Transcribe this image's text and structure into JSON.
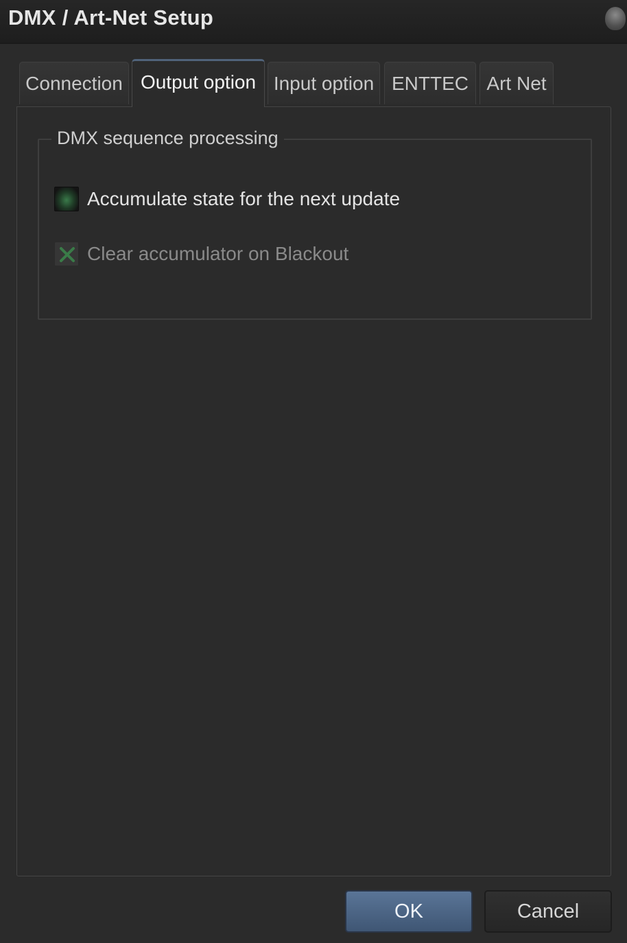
{
  "window": {
    "title": "DMX / Art-Net Setup"
  },
  "tabs": [
    {
      "label": "Connection",
      "active": false
    },
    {
      "label": "Output option",
      "active": true
    },
    {
      "label": "Input option",
      "active": false
    },
    {
      "label": "ENTTEC",
      "active": false
    },
    {
      "label": "Art Net",
      "active": false
    }
  ],
  "group": {
    "label": "DMX sequence processing",
    "options": [
      {
        "label": "Accumulate state for the next update",
        "checked": true,
        "enabled": true
      },
      {
        "label": "Clear accumulator on Blackout",
        "checked": true,
        "enabled": false
      }
    ]
  },
  "buttons": {
    "ok": "OK",
    "cancel": "Cancel"
  },
  "colors": {
    "background": "#2b2b2b",
    "accent_ok": "#4d6686",
    "checkbox_on": "#3a7a4a",
    "disabled_check": "#3d8a4e"
  },
  "icons": {
    "title_knob": "window-menu-knob-icon",
    "disabled_check": "x-check-icon"
  }
}
